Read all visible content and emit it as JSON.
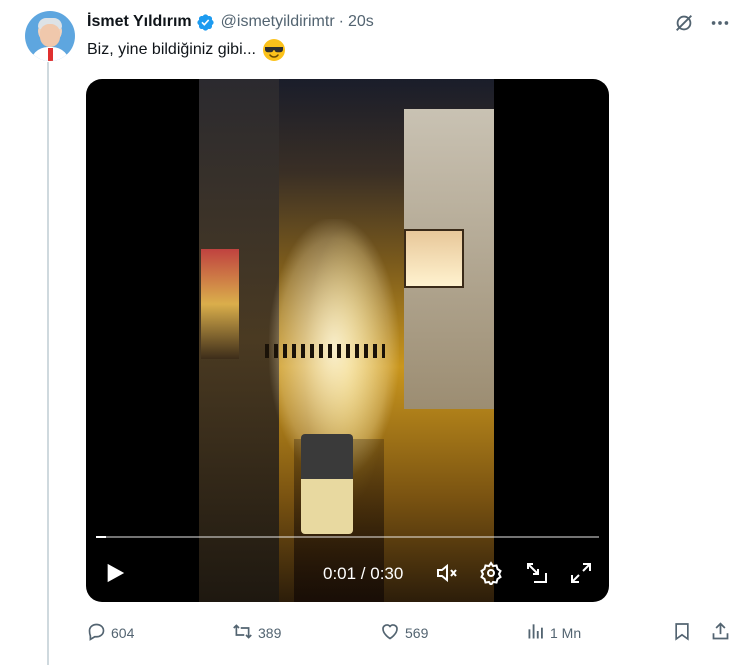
{
  "author": {
    "name": "İsmet Yıldırım",
    "handle": "@ismetyildirimtr",
    "separator": "·",
    "time": "20s"
  },
  "tweet": {
    "text": "Biz, yine bildiğiniz gibi..."
  },
  "video": {
    "time_display": "0:01 / 0:30",
    "progress_fraction": 0.02
  },
  "actions": {
    "reply_count": "604",
    "retweet_count": "389",
    "like_count": "569",
    "view_count": "1 Mn"
  },
  "colors": {
    "verified": "#1d9bf0",
    "secondary_text": "#536471",
    "thread_line": "#cfd9de"
  },
  "icons": {
    "verified": "verified-badge-icon",
    "grok": "grok-icon",
    "more": "more-icon",
    "emoji": "smiling-face-with-sunglasses-emoji",
    "play": "play-icon",
    "mute": "mute-icon",
    "settings": "settings-icon",
    "pip": "picture-in-picture-icon",
    "fullscreen": "fullscreen-icon",
    "reply": "reply-icon",
    "retweet": "retweet-icon",
    "like": "like-icon",
    "views": "views-icon",
    "bookmark": "bookmark-icon",
    "share": "share-icon"
  }
}
